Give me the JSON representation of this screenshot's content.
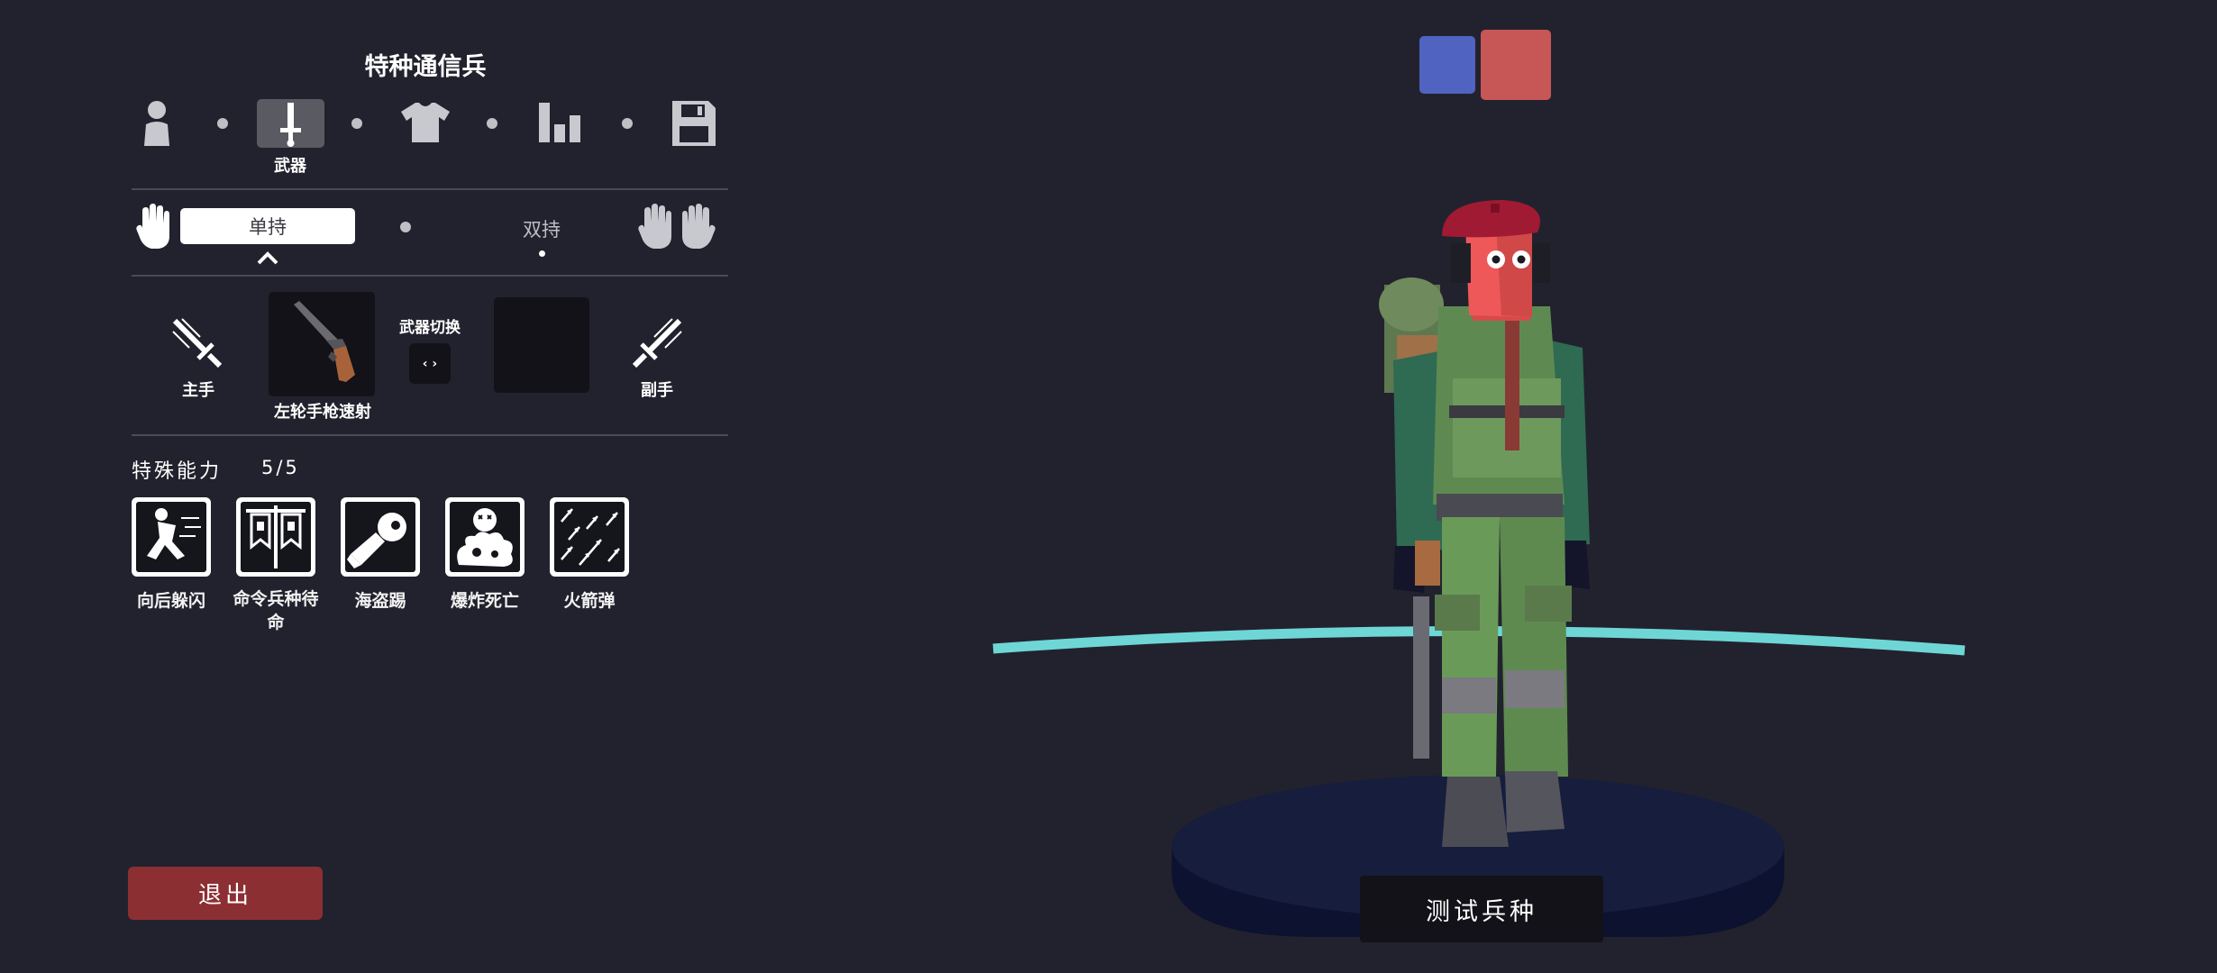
{
  "unit_title": "特种通信兵",
  "tabs": [
    {
      "icon": "person-icon"
    },
    {
      "icon": "sword-icon",
      "label": "武器"
    },
    {
      "icon": "shirt-icon"
    },
    {
      "icon": "bar-chart-icon"
    },
    {
      "icon": "save-icon"
    }
  ],
  "grip": {
    "single": "单持",
    "dual": "双持"
  },
  "weapons": {
    "main_hand_label": "主手",
    "off_hand_label": "副手",
    "equipped_weapon": "左轮手枪速射",
    "switch_label": "武器切换",
    "switch_symbol": "‹ ›"
  },
  "abilities": {
    "title": "特殊能力",
    "count": "5/5",
    "items": [
      {
        "label": "向后躲闪"
      },
      {
        "label_line1": "命令兵种待",
        "label_line2": "命"
      },
      {
        "label": "海盗踢"
      },
      {
        "label": "爆炸死亡"
      },
      {
        "label": "火箭弹"
      }
    ]
  },
  "exit_button": "退出",
  "test_button": "测试兵种",
  "colors": {
    "background": "#22222e",
    "exit_button": "#8c2f33",
    "team_blue": "#5163c0",
    "team_red": "#c75656",
    "ring": "#6fd6d6",
    "platform": "#141a35"
  }
}
